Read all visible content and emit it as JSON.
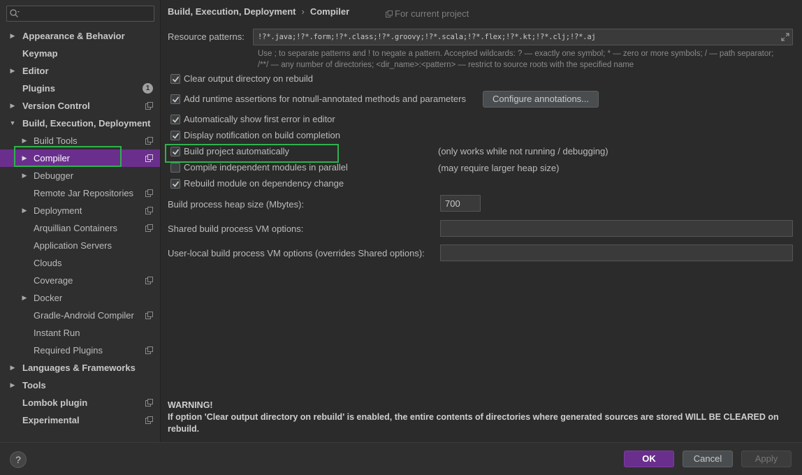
{
  "sidebar": {
    "search_placeholder": "",
    "items": [
      {
        "label": "Appearance & Behavior"
      },
      {
        "label": "Keymap"
      },
      {
        "label": "Editor"
      },
      {
        "label": "Plugins",
        "badge": "1"
      },
      {
        "label": "Version Control"
      },
      {
        "label": "Build, Execution, Deployment"
      },
      {
        "label": "Build Tools"
      },
      {
        "label": "Compiler"
      },
      {
        "label": "Debugger"
      },
      {
        "label": "Remote Jar Repositories"
      },
      {
        "label": "Deployment"
      },
      {
        "label": "Arquillian Containers"
      },
      {
        "label": "Application Servers"
      },
      {
        "label": "Clouds"
      },
      {
        "label": "Coverage"
      },
      {
        "label": "Docker"
      },
      {
        "label": "Gradle-Android Compiler"
      },
      {
        "label": "Instant Run"
      },
      {
        "label": "Required Plugins"
      },
      {
        "label": "Languages & Frameworks"
      },
      {
        "label": "Tools"
      },
      {
        "label": "Lombok plugin"
      },
      {
        "label": "Experimental"
      }
    ]
  },
  "header": {
    "crumb_parent": "Build, Execution, Deployment",
    "crumb_sep": "›",
    "crumb_current": "Compiler",
    "for_project": "For current project"
  },
  "form": {
    "resource_patterns_label": "Resource patterns:",
    "resource_patterns_value": "!?*.java;!?*.form;!?*.class;!?*.groovy;!?*.scala;!?*.flex;!?*.kt;!?*.clj;!?*.aj",
    "hint_line1": "Use ; to separate patterns and ! to negate a pattern. Accepted wildcards: ? — exactly one symbol; * — zero or more symbols; / — path separator;",
    "hint_line2": "/**/ — any number of directories; <dir_name>:<pattern> — restrict to source roots with the specified name",
    "checkboxes": [
      {
        "label": "Clear output directory on rebuild",
        "checked": true
      },
      {
        "label": "Add runtime assertions for notnull-annotated methods and parameters",
        "checked": true
      },
      {
        "label": "Automatically show first error in editor",
        "checked": true
      },
      {
        "label": "Display notification on build completion",
        "checked": true
      },
      {
        "label": "Build project automatically",
        "checked": true,
        "note": "(only works while not running / debugging)"
      },
      {
        "label": "Compile independent modules in parallel",
        "checked": false,
        "note": "(may require larger heap size)"
      },
      {
        "label": "Rebuild module on dependency change",
        "checked": true
      }
    ],
    "configure_annotations_label": "Configure annotations...",
    "heap_label": "Build process heap size (Mbytes):",
    "heap_value": "700",
    "shared_vm_label": "Shared build process VM options:",
    "shared_vm_value": "",
    "user_vm_label": "User-local build process VM options (overrides Shared options):",
    "user_vm_value": ""
  },
  "warning": {
    "title": "WARNING!",
    "text": "If option 'Clear output directory on rebuild' is enabled, the entire contents of directories where generated sources are stored WILL BE CLEARED on rebuild."
  },
  "footer": {
    "help": "?",
    "ok": "OK",
    "cancel": "Cancel",
    "apply": "Apply"
  },
  "colors": {
    "selection": "#6a2f8c",
    "highlight_box": "#2fb24c",
    "background": "#2b2b2b"
  }
}
